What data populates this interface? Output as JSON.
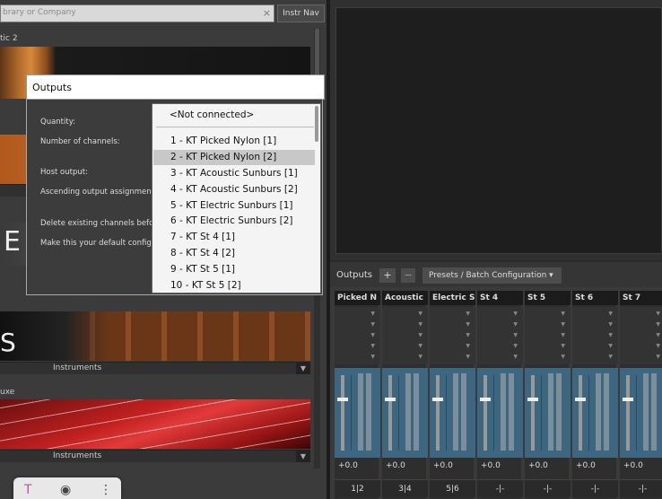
{
  "library": {
    "search_placeholder": "brary or Company",
    "search_clear": "×",
    "instr_nav_label": "Instr Nav",
    "section1_title": "tic 2",
    "image3_letter": "E",
    "image4_letter": "S",
    "bar_labels": [
      "Instruments",
      "Instruments"
    ],
    "bar_dropdown_glyph": "▼",
    "section2_title": "uxe"
  },
  "dialog": {
    "title": "Outputs",
    "labels": [
      "Quantity:",
      "Number of channels:",
      "Host output:",
      "Ascending output assignment",
      "Delete existing channels befor",
      "Make this your default configu"
    ]
  },
  "dropdown": {
    "not_connected": "<Not connected>",
    "items": [
      "1 - KT Picked Nylon [1]",
      "2 - KT Picked Nylon [2]",
      "3 - KT Acoustic Sunburs [1]",
      "4 - KT Acoustic Sunburs [2]",
      "5 - KT Electric Sunburs [1]",
      "6 - KT Electric Sunburs [2]",
      "7 - KT St 4 [1]",
      "8 - KT St 4 [2]",
      "9 - KT St 5 [1]",
      "10 - KT St 5 [2]"
    ],
    "selected_index": 1
  },
  "mixer": {
    "title": "Outputs",
    "add_label": "+",
    "remove_label": "−",
    "presets_label": "Presets / Batch Configuration ▾",
    "strips": [
      {
        "name": "Picked N",
        "volume": "+0.0",
        "route": "1|2"
      },
      {
        "name": "Acoustic",
        "volume": "+0.0",
        "route": "3|4"
      },
      {
        "name": "Electric S",
        "volume": "+0.0",
        "route": "5|6"
      },
      {
        "name": "St 4",
        "volume": "+0.0",
        "route": "-|-"
      },
      {
        "name": "St 5",
        "volume": "+0.0",
        "route": "-|-"
      },
      {
        "name": "St 6",
        "volume": "+0.0",
        "route": "-|-"
      },
      {
        "name": "St 7",
        "volume": "+0.0",
        "route": "-|-"
      }
    ]
  },
  "floating_toolbar": {
    "icons": [
      "text-tool-icon",
      "camera-icon",
      "more-icon"
    ],
    "glyphs": [
      "T",
      "◉",
      "⋮"
    ]
  }
}
